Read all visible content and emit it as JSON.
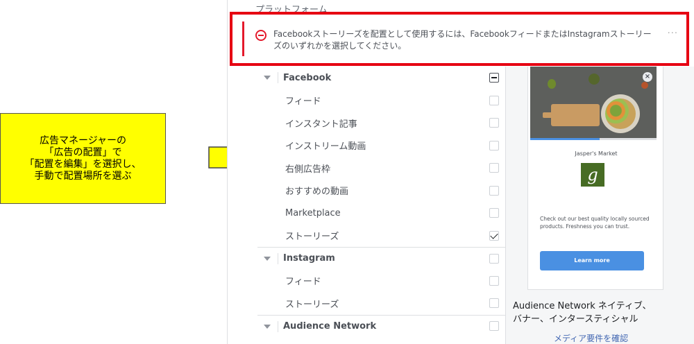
{
  "callout": {
    "lines": [
      "広告マネージャーの",
      "「広告の配置」で",
      "「配置を編集」を選択し、",
      "手動で配置場所を選ぶ"
    ]
  },
  "section_title": "プラットフォーム",
  "alert": {
    "message": "Facebookストーリーズを配置として使用するには、FacebookフィードまたはInstagramストーリーズのいずれかを選択してください。",
    "more": "···",
    "icon": "minus-circle-icon",
    "color": "#e4192b"
  },
  "placements": [
    {
      "type": "group",
      "label": "Facebook",
      "state": "indeterminate"
    },
    {
      "type": "item",
      "label": "フィード",
      "checked": false
    },
    {
      "type": "item",
      "label": "インスタント記事",
      "checked": false
    },
    {
      "type": "item",
      "label": "インストリーム動画",
      "checked": false
    },
    {
      "type": "item",
      "label": "右側広告枠",
      "checked": false
    },
    {
      "type": "item",
      "label": "おすすめの動画",
      "checked": false
    },
    {
      "type": "item",
      "label": "Marketplace",
      "checked": false
    },
    {
      "type": "item",
      "label": "ストーリーズ",
      "checked": true
    },
    {
      "type": "group",
      "label": "Instagram",
      "state": "unchecked"
    },
    {
      "type": "item",
      "label": "フィード",
      "checked": false
    },
    {
      "type": "item",
      "label": "ストーリーズ",
      "checked": false
    },
    {
      "type": "group",
      "label": "Audience Network",
      "state": "unchecked"
    }
  ],
  "preview": {
    "brand_name": "Jasper's Market",
    "logo_letter": "g",
    "ad_text": "Check out our best quality locally sourced products. Freshness you can trust.",
    "cta_label": "Learn more",
    "close_symbol": "×",
    "progress": 0.55,
    "title": "Audience Network ネイティブ、バナー、インタースティシャル",
    "link": "メディア要件を確認"
  },
  "colors": {
    "callout_bg": "#ffff00",
    "alert_border": "#e60012",
    "cta": "#4a90e2",
    "link": "#4267b2"
  }
}
